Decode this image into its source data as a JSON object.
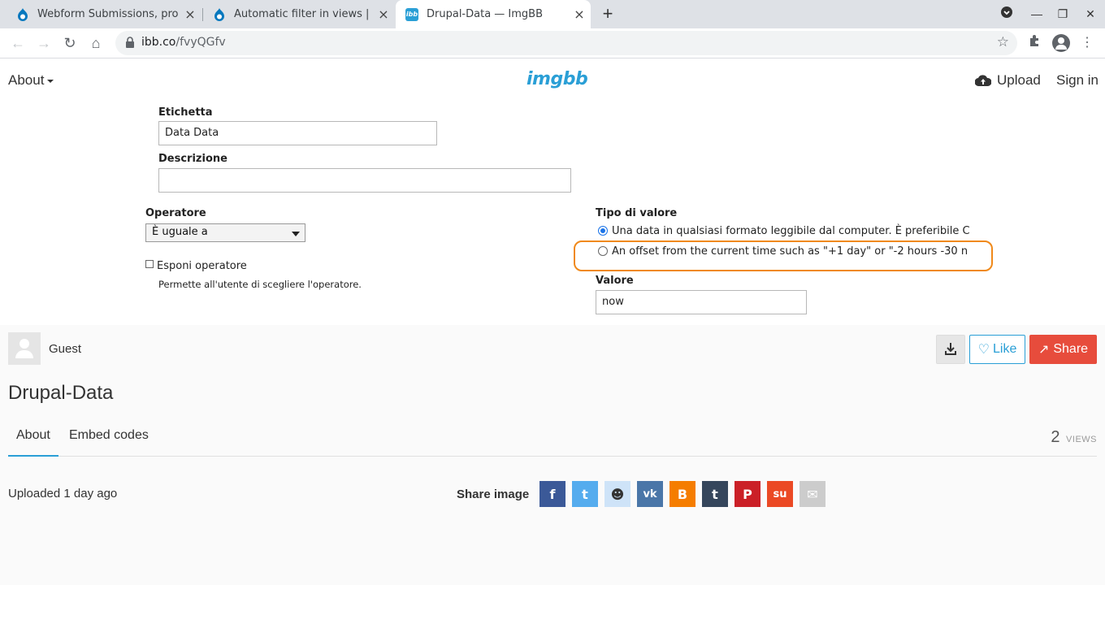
{
  "browser": {
    "tabs": [
      {
        "title": "Webform Submissions, probl",
        "active": false
      },
      {
        "title": "Automatic filter in views | Dru",
        "active": false
      },
      {
        "title": "Drupal-Data — ImgBB",
        "active": true
      }
    ],
    "url_host": "ibb.co",
    "url_path": "/fvyQGfv"
  },
  "site": {
    "about": "About",
    "logo": "imgbb",
    "upload": "Upload",
    "signin": "Sign in"
  },
  "form": {
    "etichetta_label": "Etichetta",
    "etichetta_value": "Data Data",
    "descrizione_label": "Descrizione",
    "descrizione_value": "",
    "operatore_label": "Operatore",
    "operatore_value": "È uguale a",
    "esponi_label": "Esponi operatore",
    "esponi_help": "Permette all'utente di scegliere l'operatore.",
    "tipo_label": "Tipo di valore",
    "radio1": "Una data in qualsiasi formato leggibile dal computer. È preferibile C",
    "radio2": "An offset from the current time such as \"+1 day\" or \"-2 hours -30 n",
    "valore_label": "Valore",
    "valore_value": "now"
  },
  "info": {
    "user": "Guest",
    "like": "Like",
    "share": "Share",
    "title": "Drupal-Data",
    "tab_about": "About",
    "tab_embed": "Embed codes",
    "views_count": "2",
    "views_label": "VIEWS",
    "uploaded": "Uploaded 1 day ago",
    "share_image": "Share image"
  },
  "social": [
    {
      "name": "facebook",
      "glyph": "f",
      "color": "#3b5998"
    },
    {
      "name": "twitter",
      "glyph": "t",
      "color": "#55acee"
    },
    {
      "name": "reddit",
      "glyph": "☻",
      "color": "#cee3f8"
    },
    {
      "name": "vk",
      "glyph": "vk",
      "color": "#4a76a8"
    },
    {
      "name": "blogger",
      "glyph": "B",
      "color": "#f57d00"
    },
    {
      "name": "tumblr",
      "glyph": "t",
      "color": "#35465c"
    },
    {
      "name": "pinterest",
      "glyph": "P",
      "color": "#cb2027"
    },
    {
      "name": "stumbleupon",
      "glyph": "su",
      "color": "#eb4924"
    },
    {
      "name": "email",
      "glyph": "✉",
      "color": "#cccccc"
    }
  ]
}
